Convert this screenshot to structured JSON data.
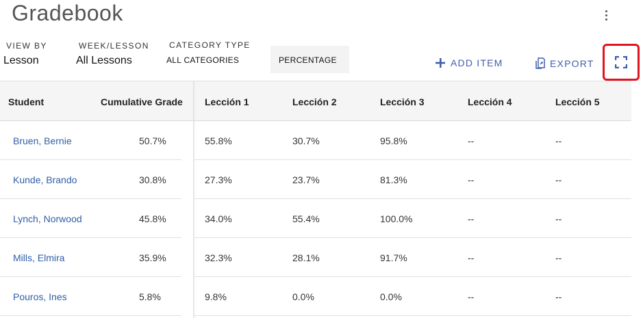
{
  "page": {
    "title": "Gradebook"
  },
  "filters": {
    "view_by": {
      "label": "VIEW BY",
      "value": "Lesson"
    },
    "week_lesson": {
      "label": "WEEK/LESSON",
      "value": "All Lessons"
    },
    "category_type": {
      "label": "CATEGORY TYPE",
      "value": "ALL CATEGORIES"
    },
    "display": {
      "value": "PERCENTAGE"
    }
  },
  "actions": {
    "add_item": "ADD ITEM",
    "export": "EXPORT",
    "fullscreen_icon": "fullscreen-icon",
    "menu_icon": "more-vert-icon"
  },
  "colors": {
    "accent": "#3f5dab",
    "link": "#2f5fa7",
    "highlight": "#e0141e"
  },
  "table": {
    "headers": [
      "Student",
      "Cumulative Grade",
      "Lección 1",
      "Lección 2",
      "Lección 3",
      "Lección 4",
      "Lección 5"
    ],
    "rows": [
      {
        "student": "Bruen, Bernie",
        "cumulative": "50.7%",
        "l1": "55.8%",
        "l2": "30.7%",
        "l3": "95.8%",
        "l4": "--",
        "l5": "--"
      },
      {
        "student": "Kunde, Brando",
        "cumulative": "30.8%",
        "l1": "27.3%",
        "l2": "23.7%",
        "l3": "81.3%",
        "l4": "--",
        "l5": "--"
      },
      {
        "student": "Lynch, Norwood",
        "cumulative": "45.8%",
        "l1": "34.0%",
        "l2": "55.4%",
        "l3": "100.0%",
        "l4": "--",
        "l5": "--"
      },
      {
        "student": "Mills, Elmira",
        "cumulative": "35.9%",
        "l1": "32.3%",
        "l2": "28.1%",
        "l3": "91.7%",
        "l4": "--",
        "l5": "--"
      },
      {
        "student": "Pouros, Ines",
        "cumulative": "5.8%",
        "l1": "9.8%",
        "l2": "0.0%",
        "l3": "0.0%",
        "l4": "--",
        "l5": "--"
      }
    ]
  }
}
